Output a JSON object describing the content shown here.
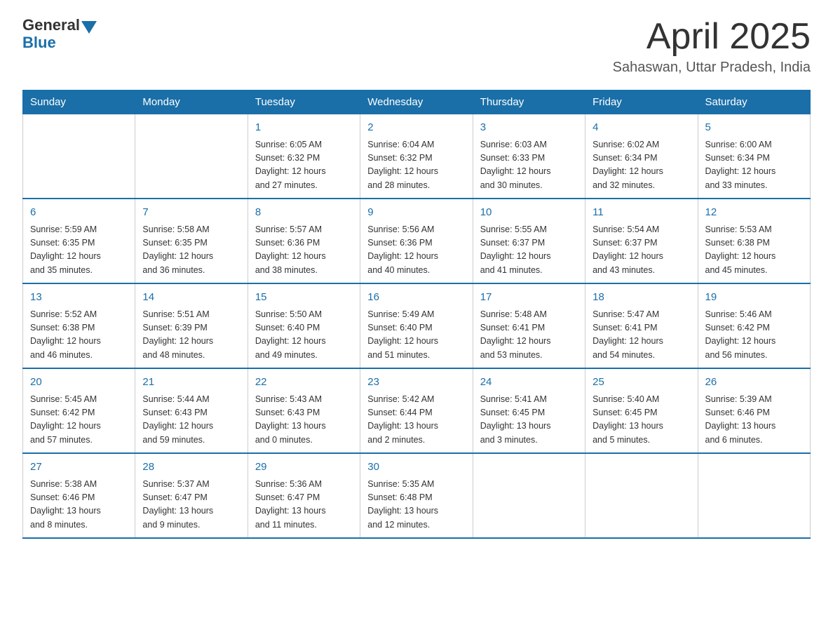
{
  "header": {
    "logo_general": "General",
    "logo_blue": "Blue",
    "calendar_title": "April 2025",
    "calendar_subtitle": "Sahaswan, Uttar Pradesh, India"
  },
  "weekdays": [
    "Sunday",
    "Monday",
    "Tuesday",
    "Wednesday",
    "Thursday",
    "Friday",
    "Saturday"
  ],
  "weeks": [
    [
      {
        "day": "",
        "info": ""
      },
      {
        "day": "",
        "info": ""
      },
      {
        "day": "1",
        "info": "Sunrise: 6:05 AM\nSunset: 6:32 PM\nDaylight: 12 hours\nand 27 minutes."
      },
      {
        "day": "2",
        "info": "Sunrise: 6:04 AM\nSunset: 6:32 PM\nDaylight: 12 hours\nand 28 minutes."
      },
      {
        "day": "3",
        "info": "Sunrise: 6:03 AM\nSunset: 6:33 PM\nDaylight: 12 hours\nand 30 minutes."
      },
      {
        "day": "4",
        "info": "Sunrise: 6:02 AM\nSunset: 6:34 PM\nDaylight: 12 hours\nand 32 minutes."
      },
      {
        "day": "5",
        "info": "Sunrise: 6:00 AM\nSunset: 6:34 PM\nDaylight: 12 hours\nand 33 minutes."
      }
    ],
    [
      {
        "day": "6",
        "info": "Sunrise: 5:59 AM\nSunset: 6:35 PM\nDaylight: 12 hours\nand 35 minutes."
      },
      {
        "day": "7",
        "info": "Sunrise: 5:58 AM\nSunset: 6:35 PM\nDaylight: 12 hours\nand 36 minutes."
      },
      {
        "day": "8",
        "info": "Sunrise: 5:57 AM\nSunset: 6:36 PM\nDaylight: 12 hours\nand 38 minutes."
      },
      {
        "day": "9",
        "info": "Sunrise: 5:56 AM\nSunset: 6:36 PM\nDaylight: 12 hours\nand 40 minutes."
      },
      {
        "day": "10",
        "info": "Sunrise: 5:55 AM\nSunset: 6:37 PM\nDaylight: 12 hours\nand 41 minutes."
      },
      {
        "day": "11",
        "info": "Sunrise: 5:54 AM\nSunset: 6:37 PM\nDaylight: 12 hours\nand 43 minutes."
      },
      {
        "day": "12",
        "info": "Sunrise: 5:53 AM\nSunset: 6:38 PM\nDaylight: 12 hours\nand 45 minutes."
      }
    ],
    [
      {
        "day": "13",
        "info": "Sunrise: 5:52 AM\nSunset: 6:38 PM\nDaylight: 12 hours\nand 46 minutes."
      },
      {
        "day": "14",
        "info": "Sunrise: 5:51 AM\nSunset: 6:39 PM\nDaylight: 12 hours\nand 48 minutes."
      },
      {
        "day": "15",
        "info": "Sunrise: 5:50 AM\nSunset: 6:40 PM\nDaylight: 12 hours\nand 49 minutes."
      },
      {
        "day": "16",
        "info": "Sunrise: 5:49 AM\nSunset: 6:40 PM\nDaylight: 12 hours\nand 51 minutes."
      },
      {
        "day": "17",
        "info": "Sunrise: 5:48 AM\nSunset: 6:41 PM\nDaylight: 12 hours\nand 53 minutes."
      },
      {
        "day": "18",
        "info": "Sunrise: 5:47 AM\nSunset: 6:41 PM\nDaylight: 12 hours\nand 54 minutes."
      },
      {
        "day": "19",
        "info": "Sunrise: 5:46 AM\nSunset: 6:42 PM\nDaylight: 12 hours\nand 56 minutes."
      }
    ],
    [
      {
        "day": "20",
        "info": "Sunrise: 5:45 AM\nSunset: 6:42 PM\nDaylight: 12 hours\nand 57 minutes."
      },
      {
        "day": "21",
        "info": "Sunrise: 5:44 AM\nSunset: 6:43 PM\nDaylight: 12 hours\nand 59 minutes."
      },
      {
        "day": "22",
        "info": "Sunrise: 5:43 AM\nSunset: 6:43 PM\nDaylight: 13 hours\nand 0 minutes."
      },
      {
        "day": "23",
        "info": "Sunrise: 5:42 AM\nSunset: 6:44 PM\nDaylight: 13 hours\nand 2 minutes."
      },
      {
        "day": "24",
        "info": "Sunrise: 5:41 AM\nSunset: 6:45 PM\nDaylight: 13 hours\nand 3 minutes."
      },
      {
        "day": "25",
        "info": "Sunrise: 5:40 AM\nSunset: 6:45 PM\nDaylight: 13 hours\nand 5 minutes."
      },
      {
        "day": "26",
        "info": "Sunrise: 5:39 AM\nSunset: 6:46 PM\nDaylight: 13 hours\nand 6 minutes."
      }
    ],
    [
      {
        "day": "27",
        "info": "Sunrise: 5:38 AM\nSunset: 6:46 PM\nDaylight: 13 hours\nand 8 minutes."
      },
      {
        "day": "28",
        "info": "Sunrise: 5:37 AM\nSunset: 6:47 PM\nDaylight: 13 hours\nand 9 minutes."
      },
      {
        "day": "29",
        "info": "Sunrise: 5:36 AM\nSunset: 6:47 PM\nDaylight: 13 hours\nand 11 minutes."
      },
      {
        "day": "30",
        "info": "Sunrise: 5:35 AM\nSunset: 6:48 PM\nDaylight: 13 hours\nand 12 minutes."
      },
      {
        "day": "",
        "info": ""
      },
      {
        "day": "",
        "info": ""
      },
      {
        "day": "",
        "info": ""
      }
    ]
  ]
}
